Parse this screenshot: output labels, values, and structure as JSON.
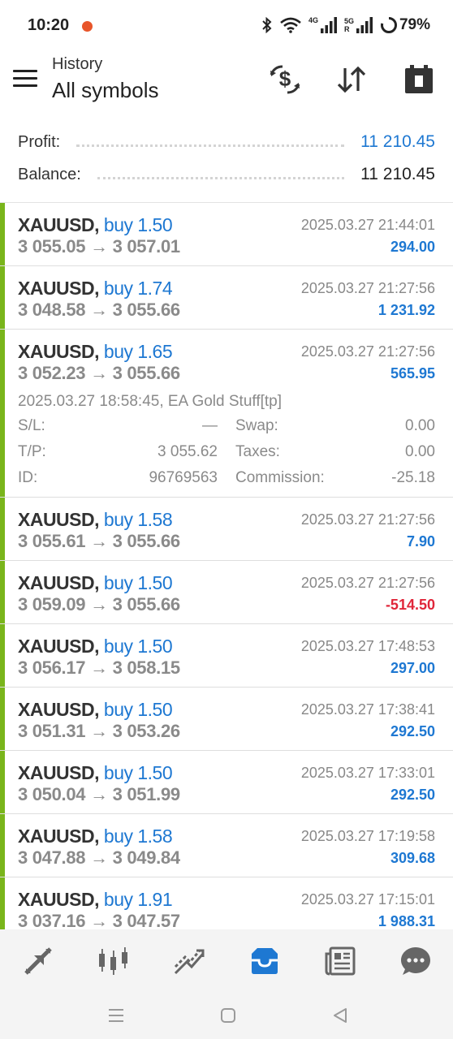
{
  "status": {
    "time": "10:20",
    "net1": "4G",
    "net2": "5G",
    "roaming": "R",
    "battery": "79%"
  },
  "header": {
    "subtitle": "History",
    "title": "All symbols"
  },
  "summary": {
    "profit_label": "Profit:",
    "profit_value": "11 210.45",
    "balance_label": "Balance:",
    "balance_value": "11 210.45"
  },
  "deals": [
    {
      "symbol": "XAUUSD,",
      "type": "buy 1.50",
      "time": "2025.03.27 21:44:01",
      "open": "3 055.05",
      "close": "3 057.01",
      "profit": "294.00"
    },
    {
      "symbol": "XAUUSD,",
      "type": "buy 1.74",
      "time": "2025.03.27 21:27:56",
      "open": "3 048.58",
      "close": "3 055.66",
      "profit": "1 231.92"
    },
    {
      "symbol": "XAUUSD,",
      "type": "buy 1.65",
      "time": "2025.03.27 21:27:56",
      "open": "3 052.23",
      "close": "3 055.66",
      "profit": "565.95",
      "details": {
        "comment": "2025.03.27 18:58:45, EA Gold Stuff[tp]",
        "sl_label": "S/L:",
        "sl_value": "—",
        "swap_label": "Swap:",
        "swap_value": "0.00",
        "tp_label": "T/P:",
        "tp_value": "3 055.62",
        "taxes_label": "Taxes:",
        "taxes_value": "0.00",
        "id_label": "ID:",
        "id_value": "96769563",
        "commission_label": "Commission:",
        "commission_value": "-25.18"
      }
    },
    {
      "symbol": "XAUUSD,",
      "type": "buy 1.58",
      "time": "2025.03.27 21:27:56",
      "open": "3 055.61",
      "close": "3 055.66",
      "profit": "7.90"
    },
    {
      "symbol": "XAUUSD,",
      "type": "buy 1.50",
      "time": "2025.03.27 21:27:56",
      "open": "3 059.09",
      "close": "3 055.66",
      "profit": "-514.50"
    },
    {
      "symbol": "XAUUSD,",
      "type": "buy 1.50",
      "time": "2025.03.27 17:48:53",
      "open": "3 056.17",
      "close": "3 058.15",
      "profit": "297.00"
    },
    {
      "symbol": "XAUUSD,",
      "type": "buy 1.50",
      "time": "2025.03.27 17:38:41",
      "open": "3 051.31",
      "close": "3 053.26",
      "profit": "292.50"
    },
    {
      "symbol": "XAUUSD,",
      "type": "buy 1.50",
      "time": "2025.03.27 17:33:01",
      "open": "3 050.04",
      "close": "3 051.99",
      "profit": "292.50"
    },
    {
      "symbol": "XAUUSD,",
      "type": "buy 1.58",
      "time": "2025.03.27 17:19:58",
      "open": "3 047.88",
      "close": "3 049.84",
      "profit": "309.68"
    },
    {
      "symbol": "XAUUSD,",
      "type": "buy 1.91",
      "time": "2025.03.27 17:15:01",
      "open": "3 037.16",
      "close": "3 047.57",
      "profit": "1 988.31"
    }
  ],
  "arrow": "→",
  "colors": {
    "accent": "#1e78d2",
    "loss": "#e0263a",
    "buy_bar": "#79b51b"
  },
  "nav": [
    "quotes-icon",
    "chart-icon",
    "trade-icon",
    "history-icon",
    "news-icon",
    "chat-icon"
  ],
  "nav_active": "history-icon"
}
